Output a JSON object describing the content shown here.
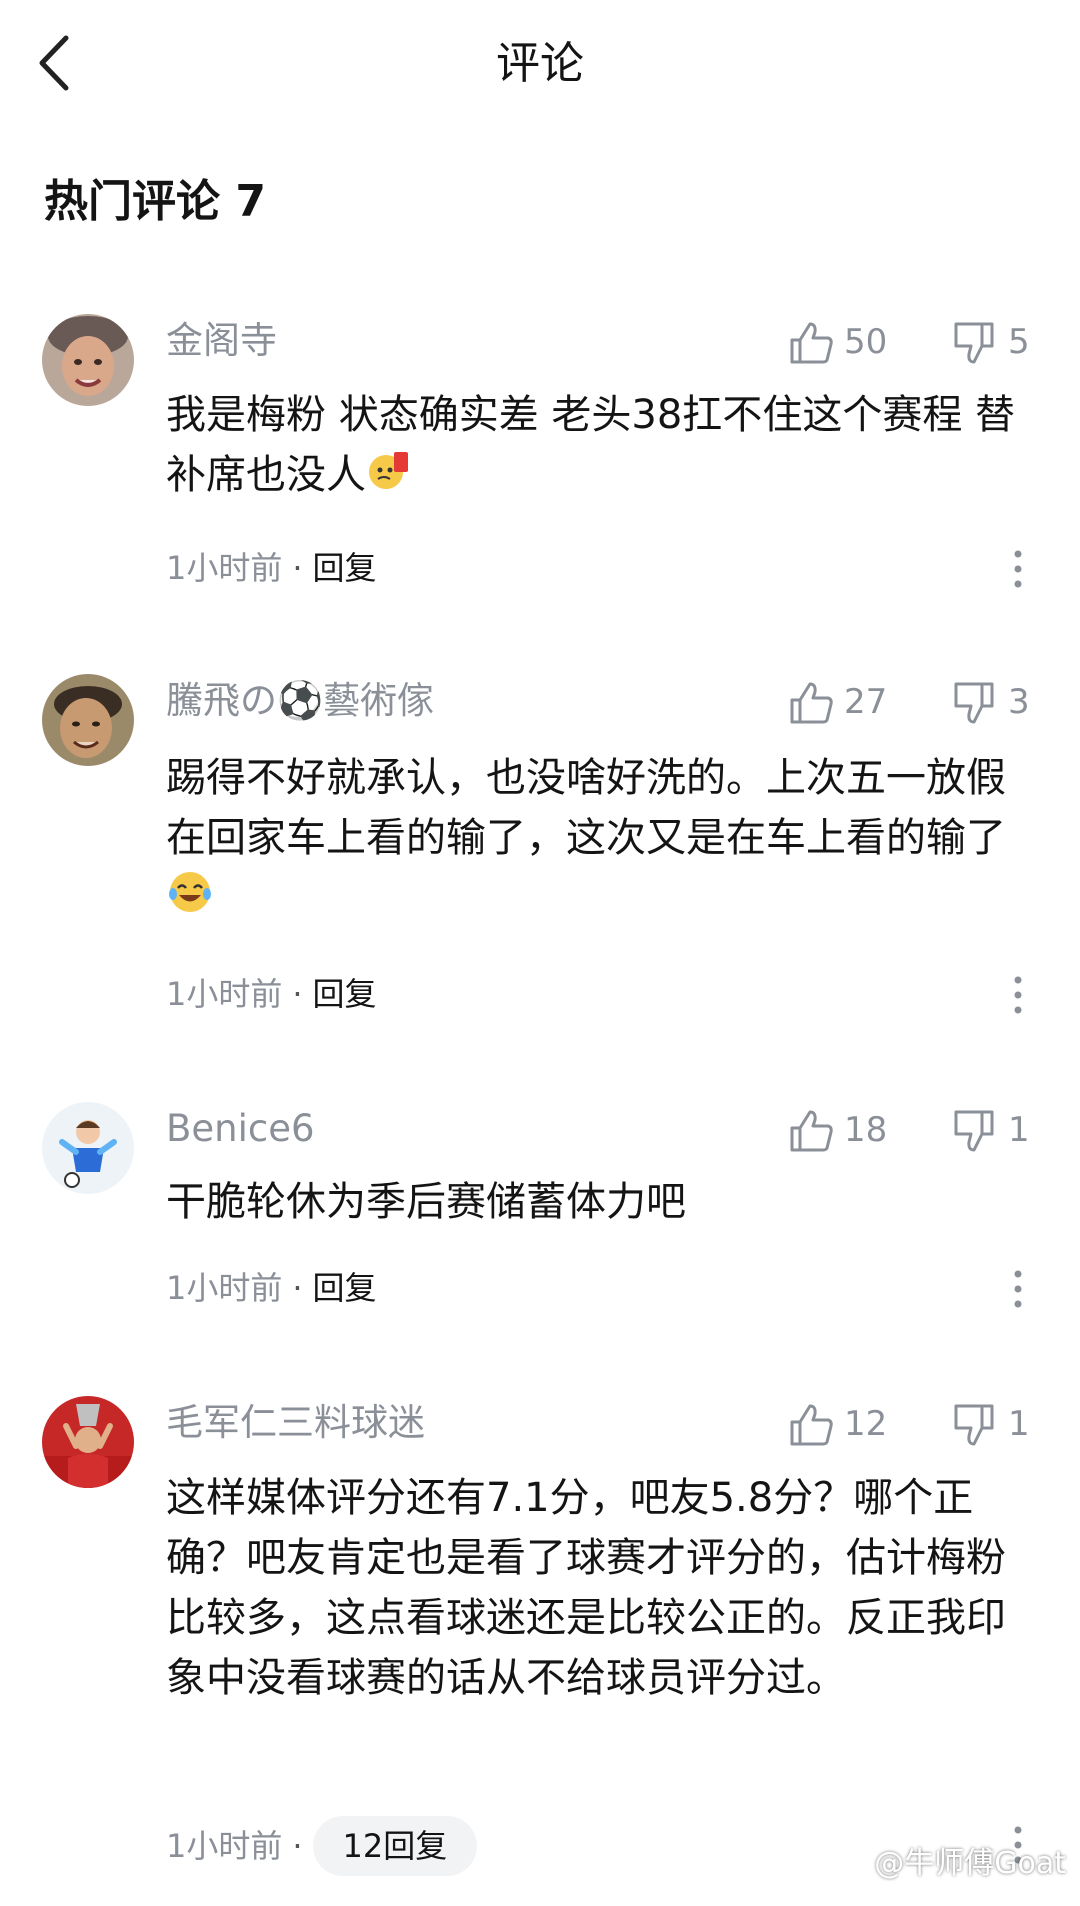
{
  "header": {
    "title": "评论",
    "back_icon": "chevron-left-icon"
  },
  "section": {
    "title": "热门评论 7"
  },
  "comments": [
    {
      "username": "金阁寺",
      "likes": "50",
      "dislikes": "5",
      "text": "我是梅粉 状态确实差 老头38扛不住这个赛程 替补席也没人",
      "emoji": "red-card-face-emoji",
      "time": "1小时前",
      "reply": "回复"
    },
    {
      "username": "騰飛の⚽藝術傢",
      "likes": "27",
      "dislikes": "3",
      "text": "踢得不好就承认，也没啥好洗的。上次五一放假在回家车上看的输了，这次又是在车上看的输了",
      "emoji": "tears-of-joy-emoji",
      "time": "1小时前",
      "reply": "回复"
    },
    {
      "username": "Benice6",
      "likes": "18",
      "dislikes": "1",
      "text": "干脆轮休为季后赛储蓄体力吧",
      "time": "1小时前",
      "reply": "回复"
    },
    {
      "username": "毛军仁三料球迷",
      "likes": "12",
      "dislikes": "1",
      "text": "这样媒体评分还有7.1分，吧友5.8分？哪个正确？吧友肯定也是看了球赛才评分的，估计梅粉比较多，这点看球迷还是比较公正的。反正我印象中没看球赛的话从不给球员评分过。",
      "time": "1小时前",
      "reply": "12回复"
    }
  ],
  "watermark": "@牛师傅Goat",
  "colors": {
    "text": "#141414",
    "muted": "#8a8f98",
    "pill_bg": "#f2f3f5",
    "background": "#ffffff"
  }
}
